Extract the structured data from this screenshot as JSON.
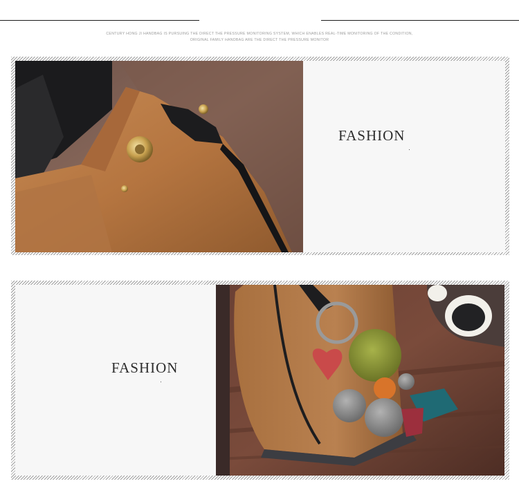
{
  "header": {
    "caption_line1": "Century Hong Ji handbag Is Pursuing the direct the pressure monitoring system, which enables real-time monitoring of the condition,",
    "caption_line2": "Original family Handbag are the direct the pressure monitor"
  },
  "section_top": {
    "title": "FASHION",
    "photo_subject": "Brown leather bucket bag with metal snap button"
  },
  "section_bottom": {
    "title": "FASHION",
    "photo_subject": "Brown bucket bag with pom-pom keychain and tassel charm beside white sunglasses"
  }
}
